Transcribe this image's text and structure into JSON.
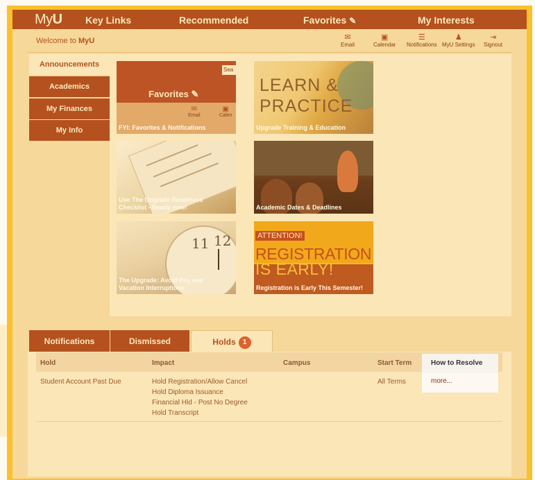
{
  "topnav": {
    "logo_prefix": "My",
    "logo_suffix": "U",
    "items": [
      "Key Links",
      "Recommended",
      "Favorites",
      "My Interests"
    ]
  },
  "welcome": {
    "prefix": "Welcome to ",
    "brand": "MyU"
  },
  "utility": [
    {
      "icon": "email-icon",
      "label": "Email"
    },
    {
      "icon": "calendar-icon",
      "label": "Calendar"
    },
    {
      "icon": "notifications-icon",
      "label": "Notifications"
    },
    {
      "icon": "user-icon",
      "label": "MyU Settings"
    },
    {
      "icon": "signout-icon",
      "label": "Signout"
    }
  ],
  "leftnav": [
    "Announcements",
    "Academics",
    "My Finances",
    "My Info"
  ],
  "tiles": {
    "t1": {
      "caption": "FYI: Favorites & Notifications",
      "title": "Favorites",
      "search": "Sea",
      "email": "Email",
      "calendar": "Calen"
    },
    "t2": {
      "caption": "Upgrade Training & Education",
      "line1": "LEARN &",
      "line2": "PRACTICE"
    },
    "t3": {
      "caption1": "Use The Upgrade Readiness",
      "caption2": "Checklist - Ready now!"
    },
    "t4": {
      "caption": "Academic Dates & Deadlines"
    },
    "t5": {
      "caption1": "The Upgrade: Avoid Pay and",
      "caption2": "Vacation Interruptions",
      "n11": "11",
      "n12": "12"
    },
    "t6": {
      "caption": "Registration is Early This Semester!",
      "attention": "ATTENTION!",
      "reg": "REGISTRATION",
      "early": "IS EARLY!"
    }
  },
  "tabs": [
    {
      "label": "Notifications"
    },
    {
      "label": "Dismissed"
    },
    {
      "label": "Holds",
      "badge": "1"
    }
  ],
  "holds": {
    "columns": [
      "Hold",
      "Impact",
      "Campus",
      "Start Term",
      "How to Resolve"
    ],
    "rows": [
      {
        "hold": "Student Account Past Due",
        "impact": [
          "Hold Registration/Allow Cancel",
          "Hold Diploma Issuance",
          "Financial Hld - Post No Degree",
          "Hold Transcript"
        ],
        "campus": "",
        "start_term": "All Terms",
        "resolve_link": "more..."
      }
    ]
  },
  "colors": {
    "frame": "#fbc02d",
    "nav": "#b4511e",
    "panel": "#f6d89a",
    "badge": "#e0612a"
  }
}
